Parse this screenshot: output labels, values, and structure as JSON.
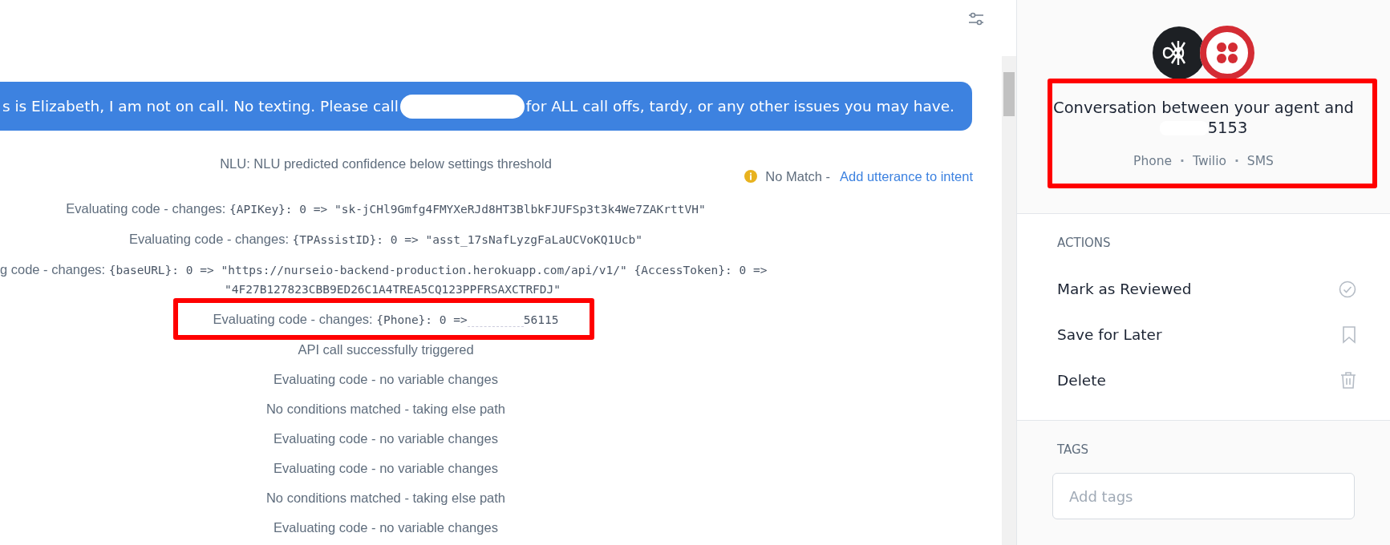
{
  "message": {
    "text_before": "s is Elizabeth, I am not on call. No texting. Please call",
    "text_after": "for ALL call offs, tardy, or any other issues you may have."
  },
  "log": [
    {
      "kind": "plain",
      "text": "NLU: NLU predicted confidence below settings threshold"
    },
    {
      "kind": "nomatch",
      "status": "No Match -",
      "link": "Add utterance to intent"
    },
    {
      "kind": "changes",
      "prefix": "Evaluating code - changes:",
      "code": "{APIKey}: 0 => \"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\""
    },
    {
      "kind": "changes",
      "prefix": "Evaluating code - changes:",
      "code": "{TPAssistID}: 0 => \"asst_17sNafLyzgFaLaUCVoKQ1Ucb\""
    },
    {
      "kind": "wrapped",
      "prefix": "g code - changes:",
      "code": "{baseURL}: 0 => \"https://nurseio-backend-production.herokuapp.com/api/v1/\" {AccessToken}: 0 =>",
      "code_cont": "\"4F27B127823CBB9ED26C1A4TREA5CQ123PPFRSAXCTRFDJ\""
    },
    {
      "kind": "redacted",
      "prefix": "Evaluating code - changes:",
      "code": "{Phone}: 0 =>",
      "tail": "56115"
    },
    {
      "kind": "plain",
      "text": "API call successfully triggered"
    },
    {
      "kind": "plain",
      "text": "Evaluating code - no variable changes"
    },
    {
      "kind": "plain",
      "text": "No conditions matched - taking else path"
    },
    {
      "kind": "plain",
      "text": "Evaluating code - no variable changes"
    },
    {
      "kind": "plain",
      "text": "Evaluating code - no variable changes"
    },
    {
      "kind": "plain",
      "text": "No conditions matched - taking else path"
    },
    {
      "kind": "plain",
      "text": "Evaluating code - no variable changes"
    }
  ],
  "conversation": {
    "title": "Conversation between your agent and",
    "phone_tail": "5153",
    "channels": [
      {
        "kind": "text",
        "text": "Phone"
      },
      {
        "kind": "separator",
        "text": "·"
      },
      {
        "kind": "text",
        "text": "Twilio"
      },
      {
        "kind": "separator",
        "text": "·"
      },
      {
        "kind": "text",
        "text": "SMS"
      }
    ]
  },
  "actions": {
    "heading": "ACTIONS",
    "items": [
      {
        "label": "Mark as Reviewed",
        "kind": "check"
      },
      {
        "label": "Save for Later",
        "kind": "bookmark"
      },
      {
        "label": "Delete",
        "kind": "trash"
      }
    ]
  },
  "tags": {
    "heading": "TAGS",
    "placeholder": "Add tags"
  },
  "annotations": [
    {
      "kind": "highlight"
    },
    {
      "kind": "highlight"
    }
  ]
}
